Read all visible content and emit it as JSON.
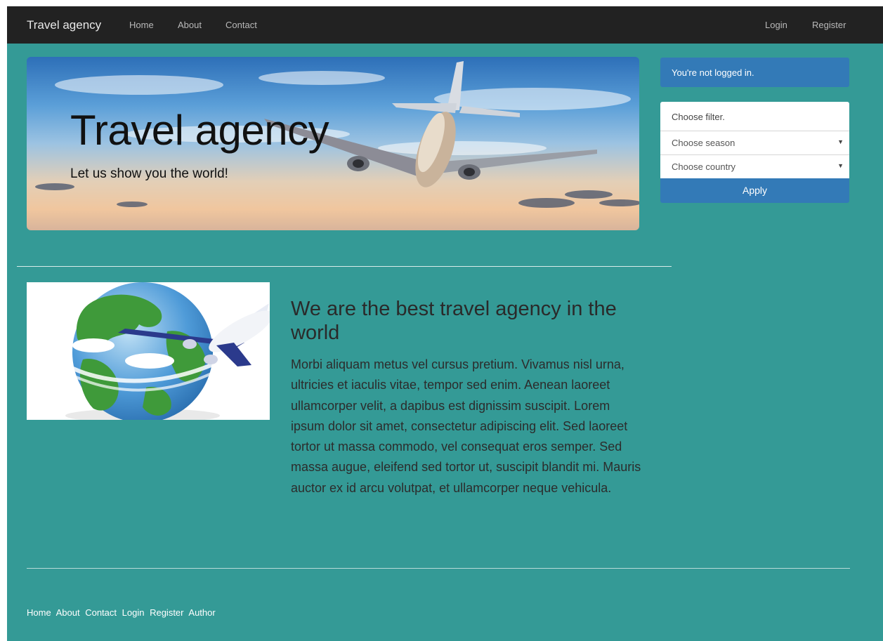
{
  "navbar": {
    "brand": "Travel agency",
    "left_links": [
      "Home",
      "About",
      "Contact"
    ],
    "right_links": [
      "Login",
      "Register"
    ]
  },
  "hero": {
    "title": "Travel agency",
    "subtitle": "Let us show you the world!"
  },
  "sidebar": {
    "alert": "You're not logged in.",
    "filter_label": "Choose filter.",
    "season_select": "Choose season",
    "country_select": "Choose country",
    "apply_label": "Apply"
  },
  "about": {
    "heading": "We are the best travel agency in the world",
    "body": "Morbi aliquam metus vel cursus pretium. Vivamus nisl urna, ultricies et iaculis vitae, tempor sed enim. Aenean laoreet ullamcorper velit, a dapibus est dignissim suscipit. Lorem ipsum dolor sit amet, consectetur adipiscing elit. Sed laoreet tortor ut massa commodo, vel consequat eros semper. Sed massa augue, eleifend sed tortor ut, suscipit blandit mi. Mauris auctor ex id arcu volutpat, et ullamcorper neque vehicula."
  },
  "footer": {
    "links": [
      "Home",
      "About",
      "Contact",
      "Login",
      "Register",
      "Author"
    ]
  },
  "icons": {
    "hero_image": "airplane-sky-photo",
    "about_image": "globe-airplane-icon",
    "select_caret": "caret-down-icon"
  },
  "colors": {
    "page_bg": "#349a96",
    "navbar_bg": "#222222",
    "primary": "#337ab7"
  }
}
